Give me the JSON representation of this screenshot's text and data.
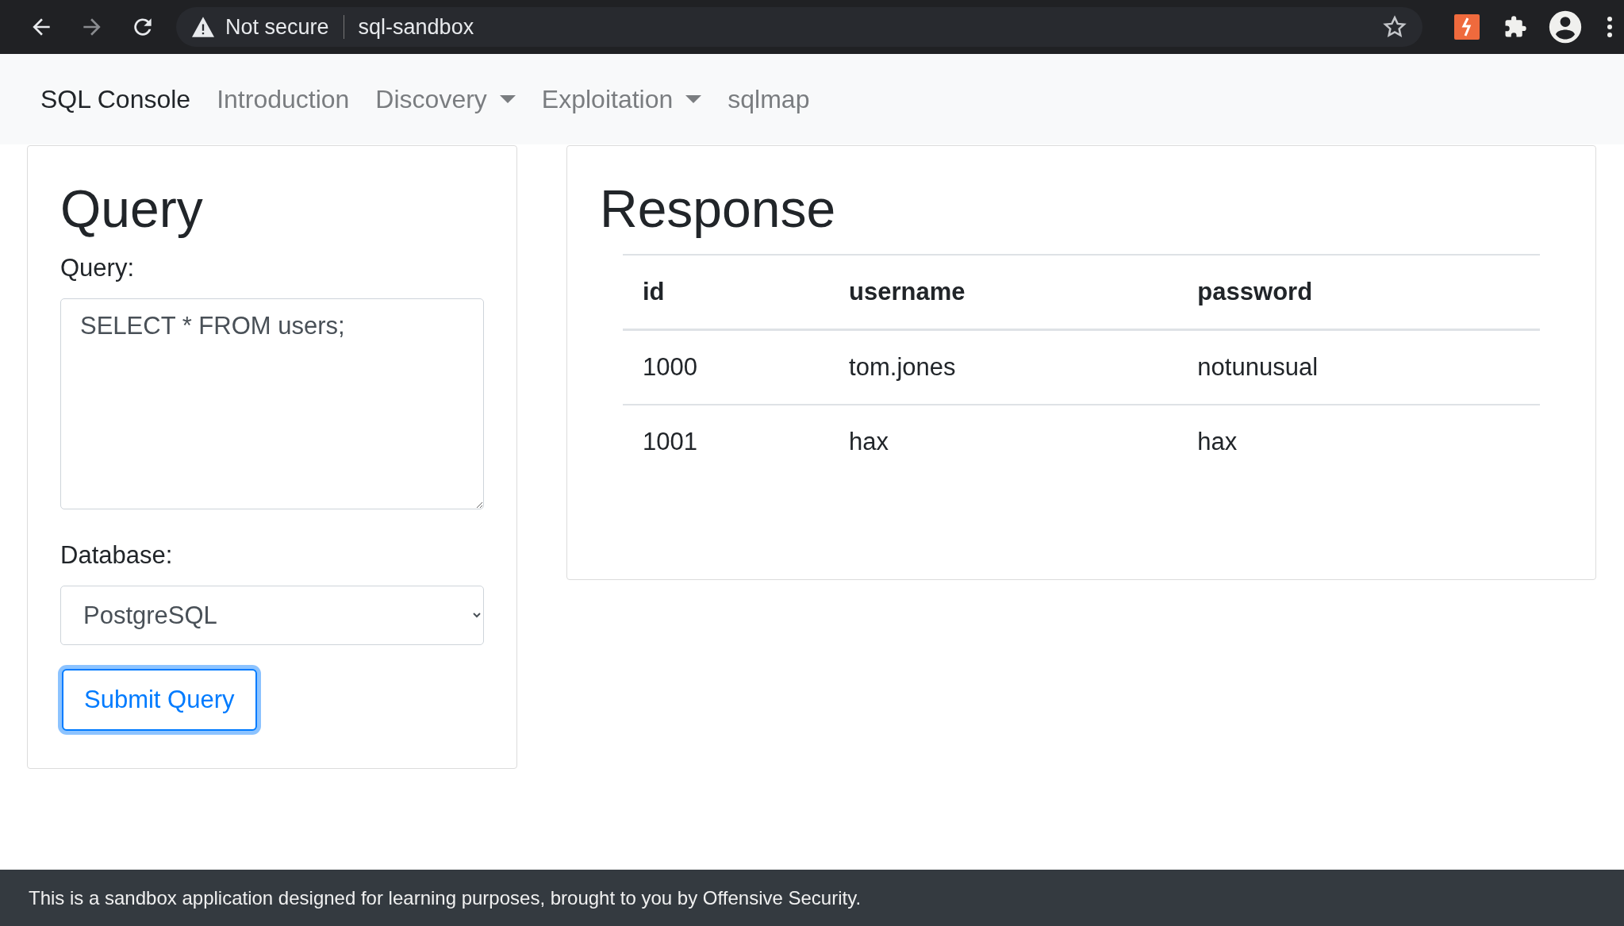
{
  "browser": {
    "security": "Not secure",
    "url": "sql-sandbox"
  },
  "navbar": {
    "brand": "SQL Console",
    "links": [
      {
        "label": "Introduction",
        "dropdown": false
      },
      {
        "label": "Discovery",
        "dropdown": true
      },
      {
        "label": "Exploitation",
        "dropdown": true
      },
      {
        "label": "sqlmap",
        "dropdown": false
      }
    ]
  },
  "query_card": {
    "title": "Query",
    "query_label": "Query:",
    "query_value": "SELECT * FROM users;",
    "database_label": "Database:",
    "database_value": "PostgreSQL",
    "submit": "Submit Query"
  },
  "response_card": {
    "title": "Response",
    "table": {
      "columns": [
        "id",
        "username",
        "password"
      ],
      "rows": [
        [
          "1000",
          "tom.jones",
          "notunusual"
        ],
        [
          "1001",
          "hax",
          "hax"
        ]
      ]
    }
  },
  "footer": "This is a sandbox application designed for learning purposes, brought to you by Offensive Security."
}
